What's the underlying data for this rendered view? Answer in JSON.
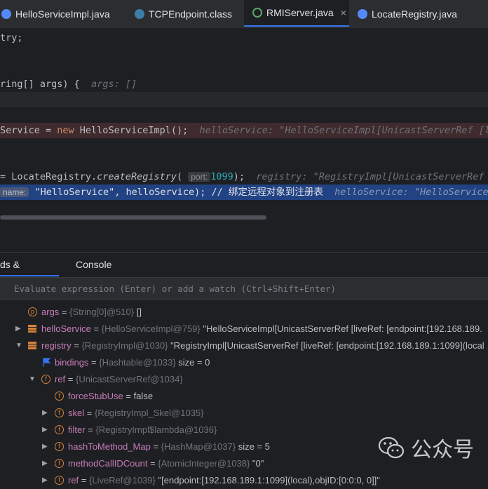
{
  "tabs": [
    {
      "label": "HelloServiceImpl.java",
      "icon": "class-icon",
      "active": false
    },
    {
      "label": "TCPEndpoint.class",
      "icon": "compiled-class-icon",
      "active": false
    },
    {
      "label": "RMIServer.java",
      "icon": "class-debug-icon",
      "active": true,
      "close": "×"
    },
    {
      "label": "LocateRegistry.java",
      "icon": "class-icon",
      "active": false
    }
  ],
  "code": {
    "l1": "try;",
    "l2_a": "ring[] args) {",
    "l2_hint": "args: []",
    "l3_a": "Service = ",
    "l3_kw": "new",
    "l3_b": " HelloServiceImpl();",
    "l3_hint": "helloService: \"HelloServiceImpl[UnicastServerRef [l",
    "l4_a": "= LocateRegistry.",
    "l4_m": "createRegistry",
    "l4_b": "(",
    "l4_param": "port:",
    "l4_num": "1099",
    "l4_c": ");",
    "l4_hint": "registry: \"RegistryImpl[UnicastServerRef",
    "l5_param": "name:",
    "l5_str": "\"HelloService\"",
    "l5_b": ", helloService); // 绑定远程对象到注册表",
    "l5_hint": "helloService: \"HelloServiceImp"
  },
  "panel": {
    "tabs": [
      "ds & Variables",
      "Console"
    ],
    "eval_placeholder": "Evaluate expression (Enter) or add a watch (Ctrl+Shift+Enter)"
  },
  "variables": [
    {
      "name": "args",
      "type": "{String[0]@510}",
      "value": "[]"
    },
    {
      "name": "helloService",
      "type": "{HelloServiceImpl@759}",
      "value": "\"HelloServiceImpl[UnicastServerRef [liveRef: [endpoint:[192.168.189."
    },
    {
      "name": "registry",
      "type": "{RegistryImpl@1030}",
      "value": "\"RegistryImpl[UnicastServerRef [liveRef: [endpoint:[192.168.189.1:1099](local"
    },
    {
      "name": "bindings",
      "type": "{Hashtable@1033}",
      "value": "size = 0"
    },
    {
      "name": "ref",
      "type": "{UnicastServerRef@1034}",
      "value": ""
    },
    {
      "name": "forceStubUse",
      "type": "",
      "value": "false"
    },
    {
      "name": "skel",
      "type": "{RegistryImpl_Skel@1035}",
      "value": ""
    },
    {
      "name": "filter",
      "type": "{RegistryImpl$lambda@1036}",
      "value": ""
    },
    {
      "name": "hashToMethod_Map",
      "type": "{HashMap@1037}",
      "value": "size = 5"
    },
    {
      "name": "methodCallIDCount",
      "type": "{AtomicInteger@1038}",
      "value": "\"0\""
    },
    {
      "name": "ref",
      "type": "{LiveRef@1039}",
      "value": "\"[endpoint:[192.168.189.1:1099](local),objID:[0:0:0, 0]]\""
    }
  ],
  "watermark": {
    "text": "公众号"
  }
}
